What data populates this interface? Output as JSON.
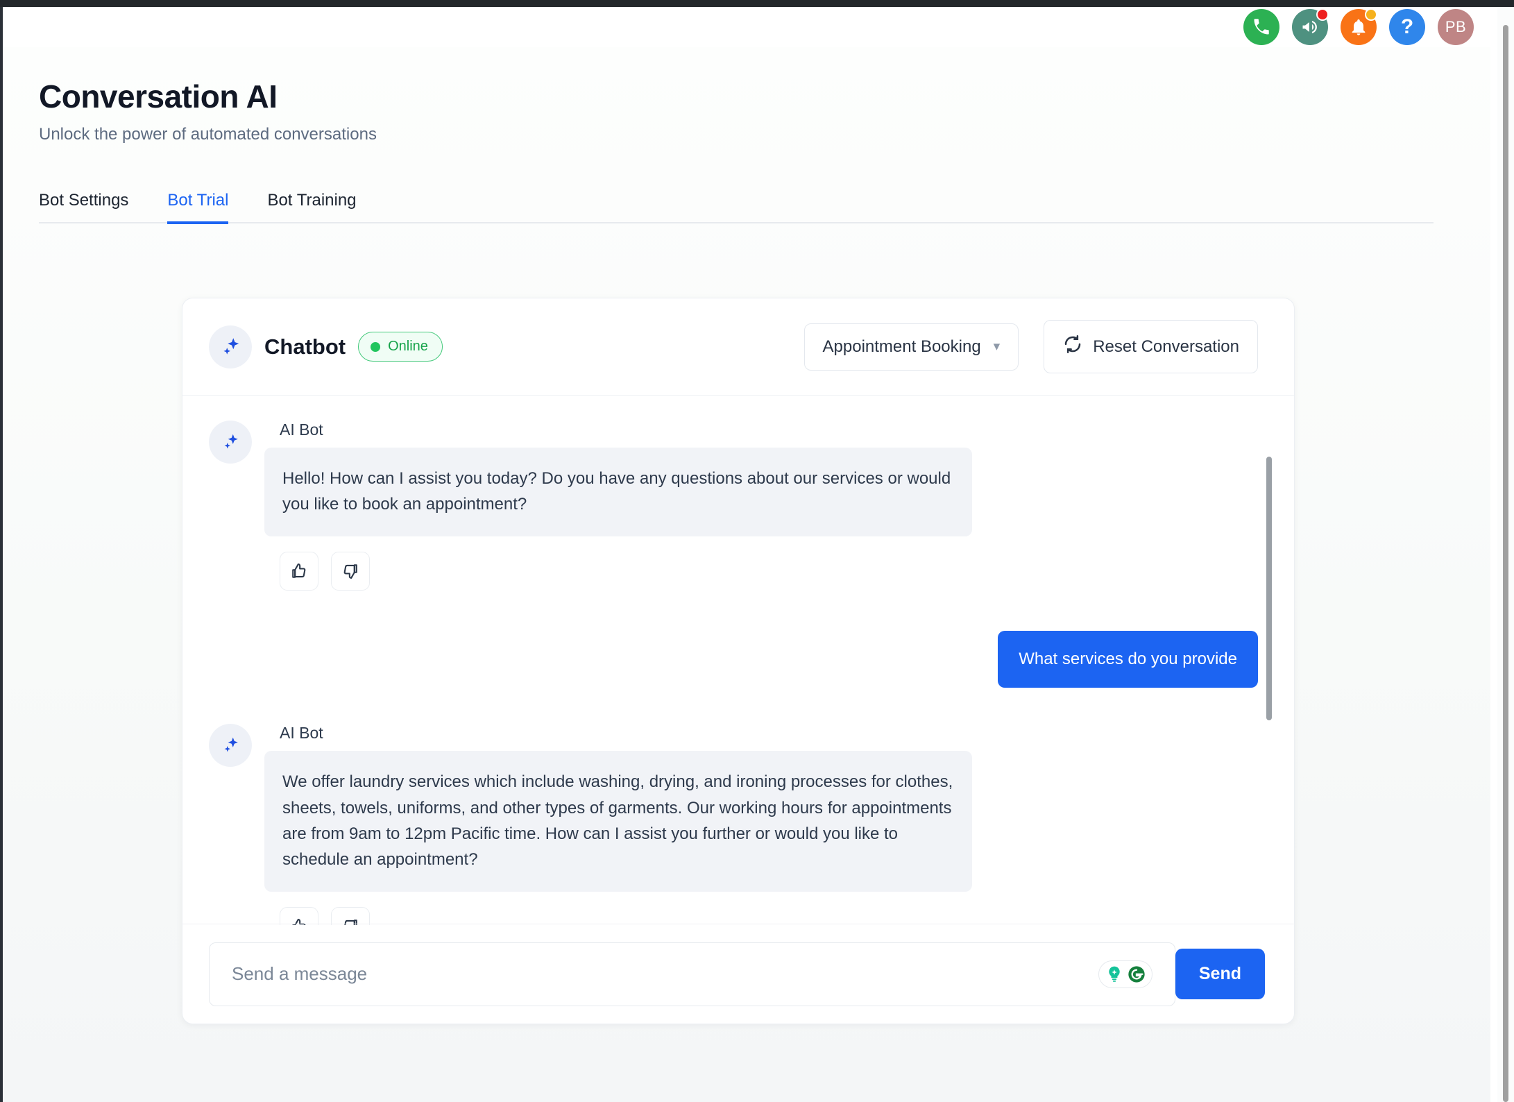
{
  "topbar": {
    "icons": [
      {
        "name": "phone-icon",
        "label": "Call"
      },
      {
        "name": "megaphone-icon",
        "label": "Announcements",
        "badge": "red"
      },
      {
        "name": "bell-icon",
        "label": "Notifications",
        "badge": "amber"
      },
      {
        "name": "help-icon",
        "label": "Help",
        "glyph": "?"
      }
    ],
    "avatar_initials": "PB"
  },
  "header": {
    "title": "Conversation AI",
    "subtitle": "Unlock the power of automated conversations"
  },
  "tabs": [
    {
      "label": "Bot Settings",
      "active": false
    },
    {
      "label": "Bot Trial",
      "active": true
    },
    {
      "label": "Bot Training",
      "active": false
    }
  ],
  "chat": {
    "bot_title": "Chatbot",
    "status_label": "Online",
    "mode_select_label": "Appointment Booking",
    "reset_label": "Reset Conversation",
    "messages": [
      {
        "sender": "AI Bot",
        "role": "bot",
        "text": "Hello! How can I assist you today? Do you have any questions about our services or would you like to book an appointment?",
        "has_feedback": true
      },
      {
        "sender": "",
        "role": "user",
        "text": "What services do you provide",
        "has_feedback": false
      },
      {
        "sender": "AI Bot",
        "role": "bot",
        "text": "We offer laundry services which include washing, drying, and ironing processes for clothes, sheets, towels, uniforms, and other types of garments. Our working hours for appointments are from 9am to 12pm Pacific time. How can I assist you further or would you like to schedule an appointment?",
        "has_feedback": true
      }
    ],
    "composer": {
      "placeholder": "Send a message",
      "value": "",
      "send_label": "Send",
      "assistant_widget": "grammarly"
    }
  },
  "colors": {
    "accent_blue": "#1c64f2",
    "online_green": "#22c55e",
    "bot_bubble": "#f1f3f7",
    "call_green": "#2cb153",
    "bell_orange": "#f97316",
    "avatar_rose": "#bf8585"
  }
}
